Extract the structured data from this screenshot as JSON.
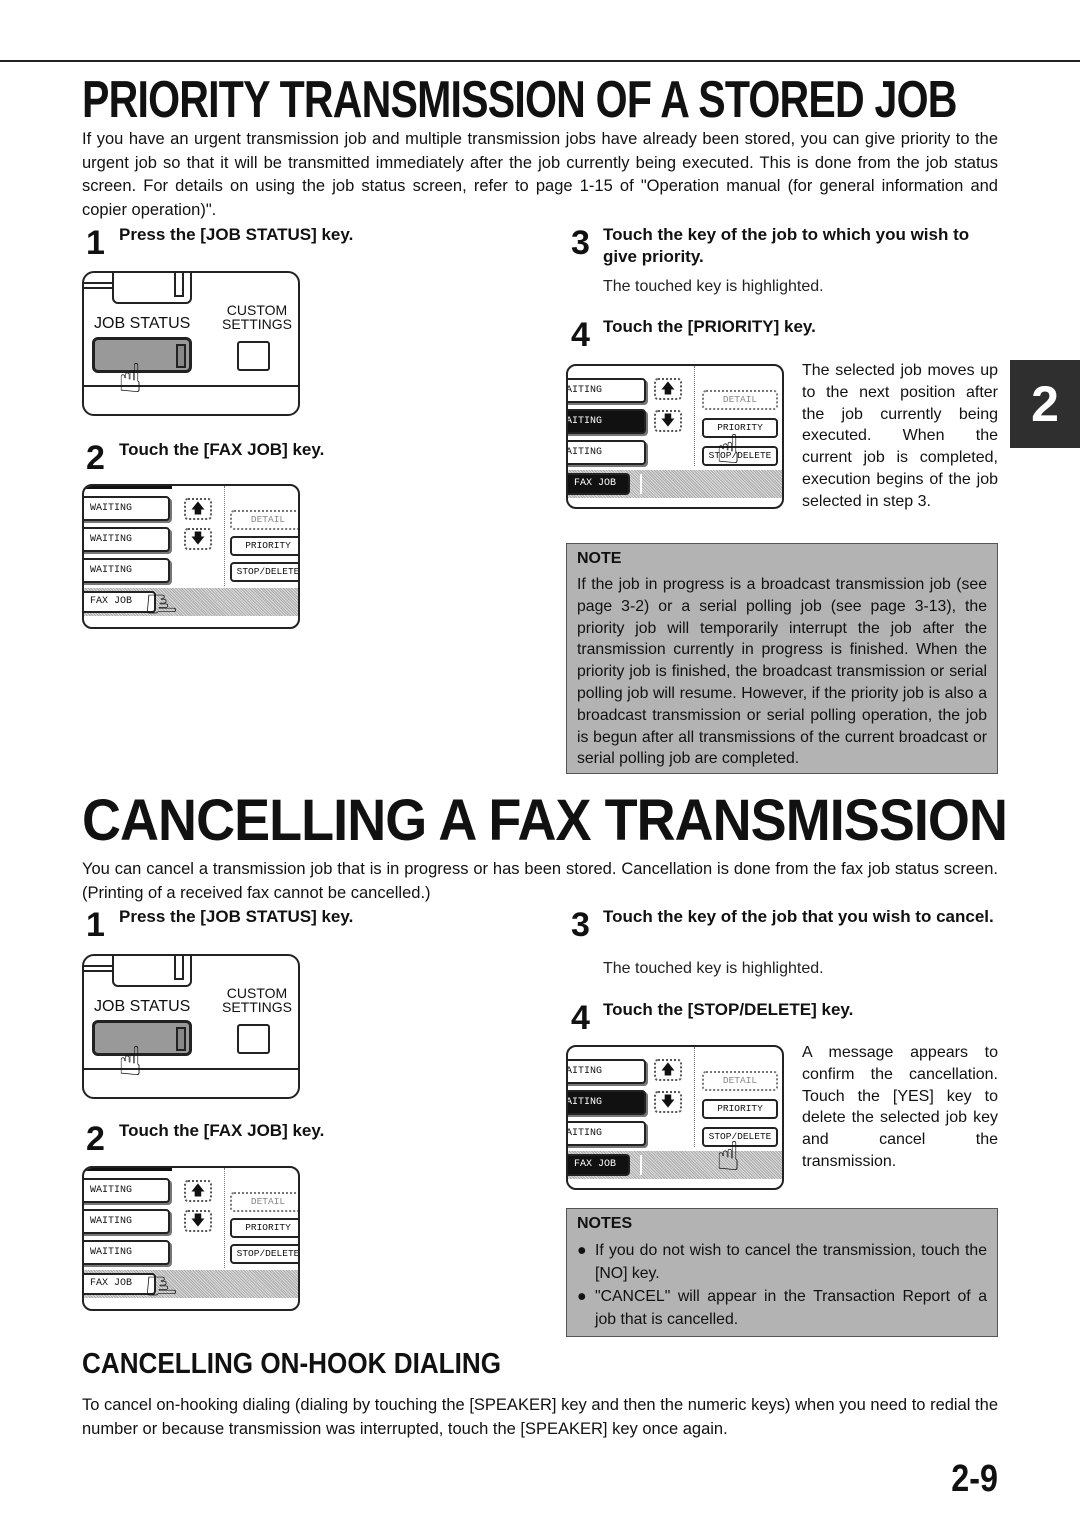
{
  "section1": {
    "title": "PRIORITY TRANSMISSION OF A STORED JOB",
    "intro": "If you have an urgent transmission job and multiple transmission jobs have already been stored, you can give priority to the urgent job so that it will be transmitted immediately after the job currently being executed. This is done from the job status screen. For details on using the job status screen, refer to page 1-15 of \"Operation manual (for general information and copier operation)\".",
    "steps": [
      {
        "num": "1",
        "title": "Press the [JOB STATUS] key."
      },
      {
        "num": "2",
        "title": "Touch the [FAX JOB] key."
      },
      {
        "num": "3",
        "title": "Touch the key of the job to which you wish to give priority.",
        "sub": "The touched key is highlighted."
      },
      {
        "num": "4",
        "title": "Touch the [PRIORITY] key.",
        "desc": "The selected job moves up to the next position after the job currently being executed. When the current job is completed, execution begins of the job selected in step 3."
      }
    ],
    "note": {
      "title": "NOTE",
      "text": "If the job in progress is a broadcast transmission job (see page 3-2) or a serial polling job (see page 3-13), the priority job will temporarily interrupt the job after the transmission currently in progress is finished. When the priority job is finished, the broadcast transmission or serial polling job will resume. However, if the priority job is also a broadcast transmission or serial polling operation, the job is begun after all transmissions of the current broadcast or serial polling job are completed."
    }
  },
  "section2": {
    "title": "CANCELLING A FAX TRANSMISSION",
    "intro": "You can cancel a transmission job that is in progress or has been stored. Cancellation is done from the fax job status screen. (Printing of a received fax cannot be cancelled.)",
    "steps": [
      {
        "num": "1",
        "title": "Press the [JOB STATUS] key."
      },
      {
        "num": "2",
        "title": "Touch the [FAX JOB] key."
      },
      {
        "num": "3",
        "title": "Touch the key of the job that you wish to cancel.",
        "sub": "The touched key is highlighted."
      },
      {
        "num": "4",
        "title": "Touch the [STOP/DELETE] key.",
        "desc": "A message appears to confirm the cancellation. Touch the [YES] key to delete the selected job key and cancel the transmission."
      }
    ],
    "notes": {
      "title": "NOTES",
      "bullet": "●",
      "items": [
        "If you do not wish to cancel the transmission, touch the [NO] key.",
        "\"CANCEL\" will appear in the Transaction Report of a job that is cancelled."
      ]
    }
  },
  "section3": {
    "title": "CANCELLING ON-HOOK DIALING",
    "text": "To cancel on-hooking dialing (dialing by touching the [SPEAKER] key and then the numeric keys) when you need to redial the number or because transmission was interrupted, touch the [SPEAKER] key once again."
  },
  "panel": {
    "job_status": "JOB STATUS",
    "custom_settings_1": "CUSTOM",
    "custom_settings_2": "SETTINGS"
  },
  "screen": {
    "job": "WAITING",
    "job_clipped": "AITING",
    "up": "🡅",
    "down": "🡇",
    "detail": "DETAIL",
    "priority": "PRIORITY",
    "stop_delete": "STOP/DELETE",
    "fax_job": "FAX JOB",
    "hand": "☝"
  },
  "chapter_tab": "2",
  "page_number": "2-9"
}
